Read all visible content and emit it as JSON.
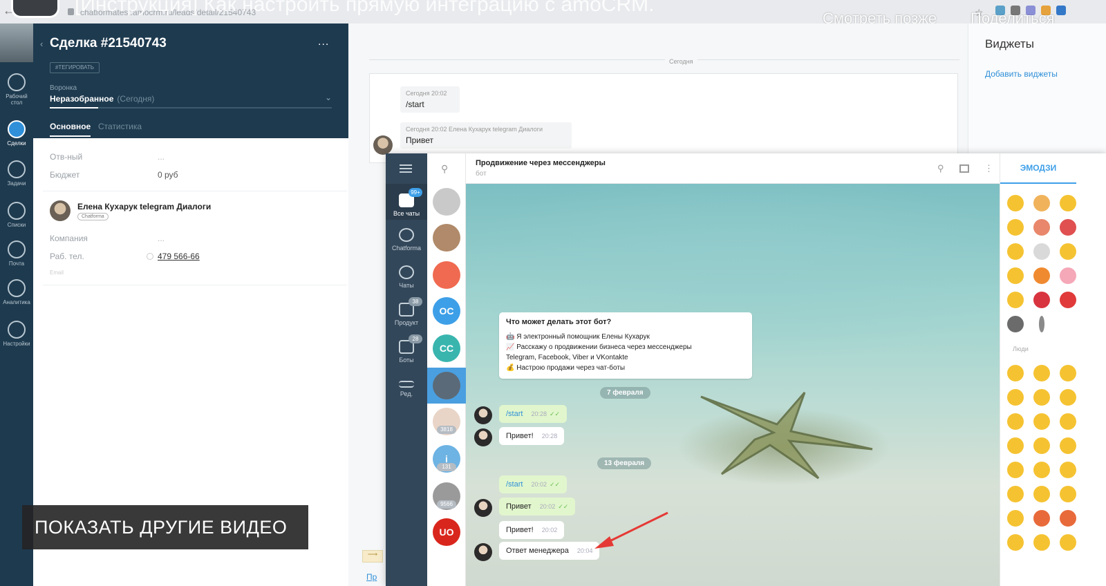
{
  "video": {
    "title": "[Инструкция] Как настроить прямую интеграцию с amoCRM.",
    "watch_later": "Смотреть позже",
    "share": "Поделиться",
    "show_more": "ПОКАЗАТЬ ДРУГИЕ ВИДЕО"
  },
  "browser": {
    "url": "chatformatest.amocrm.ru/leads/detail/21540743"
  },
  "amo_nav": {
    "items": [
      {
        "label": "Рабочий стол",
        "icon": "dashboard-icon"
      },
      {
        "label": "Сделки",
        "icon": "deals-icon",
        "active": true
      },
      {
        "label": "Задачи",
        "icon": "tasks-icon"
      },
      {
        "label": "Списки",
        "icon": "lists-icon"
      },
      {
        "label": "Почта",
        "icon": "mail-icon"
      },
      {
        "label": "Аналитика",
        "icon": "analytics-icon"
      },
      {
        "label": "Настройки",
        "icon": "settings-icon"
      }
    ]
  },
  "lead": {
    "title": "Сделка #21540743",
    "more": "...",
    "tag_button": "#ТЕГИРОВАТЬ",
    "funnel_label": "Воронка",
    "funnel_value": "Неразобранное",
    "funnel_sub": "(Сегодня)",
    "tabs": [
      "Основное",
      "Статистика"
    ],
    "fields": [
      {
        "label": "Отв-ный",
        "value": "..."
      },
      {
        "label": "Бюджет",
        "value": "0 руб"
      }
    ],
    "contact": {
      "name": "Елена Кухарук telegram Диалоги",
      "badge": "Chatforma",
      "company_label": "Компания",
      "company_value": "...",
      "phone_label": "Раб. тел.",
      "phone_value": "479 566-66",
      "email_label": "Email"
    }
  },
  "feed": {
    "today": "Сегодня",
    "messages": [
      {
        "meta": "Сегодня 20:02",
        "text": "/start"
      },
      {
        "meta": "Сегодня 20:02 Елена Кухарук telegram Диалоги",
        "text": "Привет"
      }
    ],
    "bottom_link": "Пр"
  },
  "widgets": {
    "title": "Виджеты",
    "add": "Добавить виджеты"
  },
  "telegram": {
    "nav": [
      {
        "label": "Все чаты",
        "badge": "99+",
        "active": true
      },
      {
        "label": "Chatforma",
        "badge": ""
      },
      {
        "label": "Чаты",
        "badge": ""
      },
      {
        "label": "Продукт",
        "badge": "38"
      },
      {
        "label": "Боты",
        "badge": "28"
      },
      {
        "label": "Ред.",
        "badge": ""
      }
    ],
    "chat_list": [
      {
        "initials": "",
        "color": "#c9c9c9",
        "badge": ""
      },
      {
        "initials": "",
        "color": "#b08a6a",
        "badge": ""
      },
      {
        "initials": "",
        "color": "#ef6a50",
        "badge": ""
      },
      {
        "initials": "OC",
        "color": "#3d9fe8",
        "badge": ""
      },
      {
        "initials": "CC",
        "color": "#39b5ae",
        "badge": ""
      },
      {
        "initials": "",
        "color": "#5b6a78",
        "badge": ""
      },
      {
        "initials": "",
        "color": "#e9d5c7",
        "badge": "3818"
      },
      {
        "initials": "i",
        "color": "#6db3e3",
        "badge": "131"
      },
      {
        "initials": "",
        "color": "#9a9a9a",
        "badge": "9566"
      },
      {
        "initials": "UO",
        "color": "#d9261c",
        "badge": ""
      }
    ],
    "header": {
      "title": "Продвижение через мессенджеры",
      "subtitle": "бот"
    },
    "bot_card": {
      "question": "Что может делать этот бот?",
      "lines": [
        "🤖 Я электронный помощник Елены Кухарук",
        "📈 Расскажу о продвижении бизнеса через мессенджеры",
        "Telegram, Facebook, Viber и VKontakte",
        "💰 Настрою продажи через чат-боты"
      ]
    },
    "dates": [
      "7 февраля",
      "13 февраля"
    ],
    "messages": [
      {
        "text": "/start",
        "time": "20:28",
        "dir": "out"
      },
      {
        "text": "Привет!",
        "time": "20:28",
        "dir": "in"
      },
      {
        "text": "/start",
        "time": "20:02",
        "dir": "out"
      },
      {
        "text": "Привет",
        "time": "20:02",
        "dir": "in"
      },
      {
        "text": "Привет!",
        "time": "20:02",
        "dir": "in"
      },
      {
        "text": "Ответ менеджера",
        "time": "20:04",
        "dir": "in"
      }
    ],
    "emoji_tab": "ЭМОДЗИ",
    "emoji_section": "Люди"
  },
  "colors": {
    "amo_dark": "#1e3a4f",
    "tg_nav": "#33475a",
    "accent_blue": "#3d9fe8",
    "out_bubble": "#e1f6cd",
    "arrow": "#e53935"
  }
}
